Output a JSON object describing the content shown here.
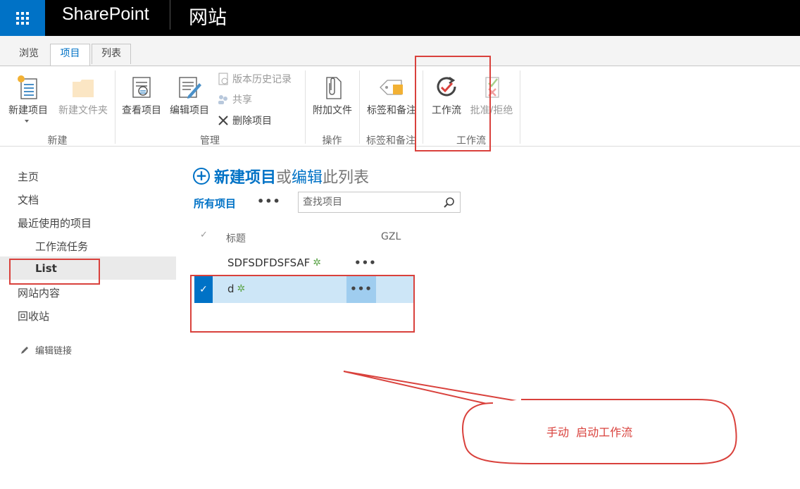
{
  "suite": {
    "brand": "SharePoint",
    "site": "网站"
  },
  "tabs": [
    {
      "label": "浏览"
    },
    {
      "label": "项目"
    },
    {
      "label": "列表"
    }
  ],
  "ribbon": {
    "new_item": "新建项目",
    "new_folder": "新建文件夹",
    "group_new": "新建",
    "view_item": "查看项目",
    "edit_item": "编辑项目",
    "version_history": "版本历史记录",
    "share": "共享",
    "delete_item": "删除项目",
    "group_manage": "管理",
    "attach_file": "附加文件",
    "group_actions": "操作",
    "tags_notes": "标签和备注",
    "group_tags": "标签和备注",
    "workflow": "工作流",
    "approve_reject": "批准/拒绝",
    "group_workflow": "工作流"
  },
  "leftnav": {
    "items": [
      "主页",
      "文档",
      "最近使用的项目",
      "工作流任务",
      "List",
      "网站内容",
      "回收站"
    ],
    "edit_links": "编辑链接"
  },
  "main": {
    "new_item_parts": [
      "新建项目",
      "或",
      "编辑",
      "此列表"
    ],
    "view_name": "所有项目",
    "view_more": "•••",
    "search_placeholder": "查找项目",
    "columns": {
      "check": "✓",
      "title": "标题",
      "gzl": "GZL"
    },
    "rows": [
      {
        "title": "SDFSDFDSFSAF",
        "menu": "•••"
      },
      {
        "title": "d",
        "menu": "•••"
      }
    ]
  },
  "annotation": {
    "text": "手动  启动工作流"
  },
  "colors": {
    "accent": "#0072c6",
    "annotation": "#d9413c",
    "selected_row": "#cde6f7"
  }
}
